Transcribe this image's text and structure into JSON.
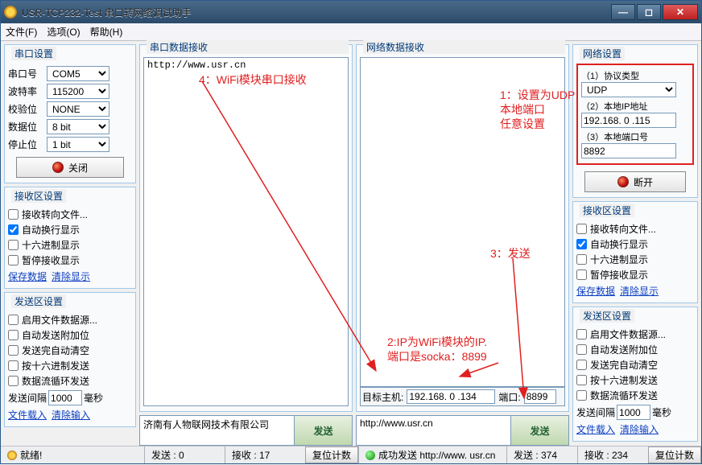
{
  "window": {
    "title": "USR-TCP232-Test 串口转网络调试助手"
  },
  "menu": {
    "file": "文件(F)",
    "options": "选项(O)",
    "help": "帮助(H)"
  },
  "serial_settings": {
    "title": "串口设置",
    "port_label": "串口号",
    "port": "COM5",
    "baud_label": "波特率",
    "baud": "115200",
    "parity_label": "校验位",
    "parity": "NONE",
    "data_label": "数据位",
    "data": "8 bit",
    "stop_label": "停止位",
    "stop": "1 bit",
    "close_btn": "关闭"
  },
  "recv_settings_left": {
    "title": "接收区设置",
    "to_file": "接收转向文件...",
    "auto_wrap": "自动换行显示",
    "hex": "十六进制显示",
    "pause": "暂停接收显示",
    "save": "保存数据",
    "clear": "清除显示"
  },
  "send_settings_left": {
    "title": "发送区设置",
    "from_file": "启用文件数据源...",
    "auto_append": "自动发送附加位",
    "auto_clear": "发送完自动清空",
    "hex_send": "按十六进制发送",
    "loop": "数据流循环发送",
    "interval_label": "发送间隔",
    "interval_val": "1000",
    "interval_unit": "毫秒",
    "file_load": "文件载入",
    "clear_input": "清除输入"
  },
  "serial_recv": {
    "title": "串口数据接收",
    "content": "http://www.usr.cn"
  },
  "serial_send": {
    "text": "济南有人物联网技术有限公司",
    "btn": "发送"
  },
  "net_recv": {
    "title": "网络数据接收",
    "content": ""
  },
  "net_host": {
    "label": "目标主机:",
    "ip": "192.168. 0 .134",
    "port_label": "端口:",
    "port": "8899"
  },
  "net_send": {
    "text": "http://www.usr.cn",
    "btn": "发送"
  },
  "net_settings": {
    "title": "网络设置",
    "proto_label": "（1）协议类型",
    "proto": "UDP",
    "ip_label": "（2）本地IP地址",
    "ip": "192.168. 0 .115",
    "port_label": "（3）本地端口号",
    "port": "8892",
    "disconnect_btn": "断开"
  },
  "recv_settings_right": {
    "title": "接收区设置",
    "to_file": "接收转向文件...",
    "auto_wrap": "自动换行显示",
    "hex": "十六进制显示",
    "pause": "暂停接收显示",
    "save": "保存数据",
    "clear": "清除显示"
  },
  "send_settings_right": {
    "title": "发送区设置",
    "from_file": "启用文件数据源...",
    "auto_append": "自动发送附加位",
    "auto_clear": "发送完自动清空",
    "hex_send": "按十六进制发送",
    "loop": "数据流循环发送",
    "interval_label": "发送间隔",
    "interval_val": "1000",
    "interval_unit": "毫秒",
    "file_load": "文件载入",
    "clear_input": "清除输入"
  },
  "status": {
    "ready": "就绪!",
    "sent_l": "发送 : 0",
    "recv_l": "接收 : 17",
    "reset_l": "复位计数",
    "net_ok": "成功发送 http://www. usr.cn",
    "sent_r": "发送 : 374",
    "recv_r": "接收 : 234",
    "reset_r": "复位计数"
  },
  "annotations": {
    "a1": "1：设置为UDP\n本地端口\n任意设置",
    "a2": "2:IP为WiFi模块的IP.\n端口是socka：8899",
    "a3": "3：发送",
    "a4": "4：WiFi模块串口接收"
  }
}
